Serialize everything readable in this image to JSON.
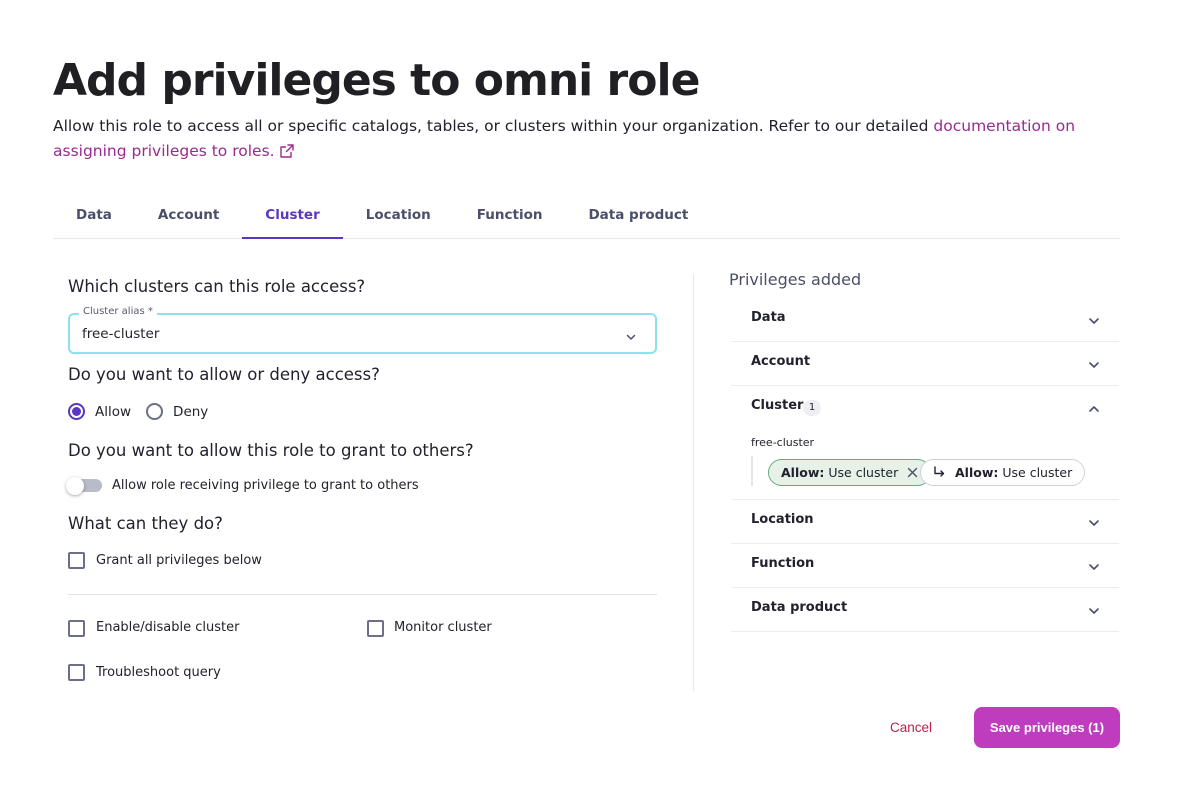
{
  "page": {
    "title": "Add privileges to omni role",
    "description_prefix": "Allow this role to access all or specific catalogs, tables, or clusters within your organization. Refer to our detailed ",
    "doc_link": "documentation on assigning privileges to roles."
  },
  "tabs": [
    {
      "label": "Data"
    },
    {
      "label": "Account"
    },
    {
      "label": "Cluster",
      "active": true
    },
    {
      "label": "Location"
    },
    {
      "label": "Function"
    },
    {
      "label": "Data product"
    }
  ],
  "form": {
    "q_clusters": "Which clusters can this role access?",
    "cluster_select": {
      "label": "Cluster alias *",
      "value": "free-cluster"
    },
    "q_access": "Do you want to allow or deny access?",
    "radio_allow": "Allow",
    "radio_deny": "Deny",
    "selected_access": "Allow",
    "q_grant": "Do you want to allow this role to grant to others?",
    "toggle_label": "Allow role receiving privilege to grant to others",
    "toggle_on": false,
    "q_what": "What can they do?",
    "cb_grant_all": "Grant all privileges below",
    "cb_enable_disable": "Enable/disable cluster",
    "cb_monitor": "Monitor cluster",
    "cb_troubleshoot": "Troubleshoot query"
  },
  "privileges": {
    "title": "Privileges added",
    "sections": [
      {
        "label": "Data"
      },
      {
        "label": "Account"
      },
      {
        "label": "Cluster",
        "count": "1",
        "expanded": true
      },
      {
        "label": "Location"
      },
      {
        "label": "Function"
      },
      {
        "label": "Data product"
      }
    ],
    "cluster_entry": {
      "name": "free-cluster",
      "chip_main": {
        "prefix": "Allow:",
        "text": "Use cluster"
      },
      "chip_inherited": {
        "prefix": "Allow:",
        "text": "Use cluster"
      }
    }
  },
  "actions": {
    "cancel": "Cancel",
    "save": "Save privileges (1)"
  },
  "colors": {
    "accent": "#5a35c8",
    "link": "#9a2a8f",
    "save_button": "#c03cbf",
    "cancel_text": "#c02048",
    "select_border": "#8fe0ee",
    "chip_green_bg": "#e6f2e8"
  }
}
